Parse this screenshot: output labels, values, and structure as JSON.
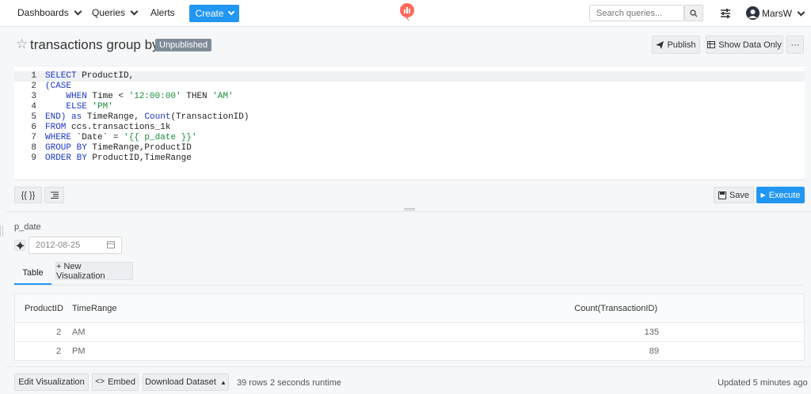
{
  "nav": {
    "dashboards": "Dashboards",
    "queries": "Queries",
    "alerts": "Alerts",
    "create": "Create",
    "search_placeholder": "Search queries...",
    "user": "MarsW"
  },
  "query": {
    "title": "transactions group by",
    "status_badge": "Unpublished",
    "publish": "Publish",
    "show_data_only": "Show Data Only",
    "more": "···"
  },
  "editor": {
    "lines": [
      {
        "n": "1",
        "html": "<span class=\"kw\">SELECT</span> ProductID,"
      },
      {
        "n": "2",
        "html": "<span class=\"kw\">(CASE</span>"
      },
      {
        "n": "3",
        "html": "    <span class=\"kw\">WHEN</span> Time &lt; <span class=\"str\">'12:00:00'</span> THEN <span class=\"str\">'AM'</span>"
      },
      {
        "n": "4",
        "html": "    <span class=\"kw\">ELSE</span> <span class=\"str\">'PM'</span>"
      },
      {
        "n": "5",
        "html": "<span class=\"kw\">END)</span> <span class=\"kw\">as</span> TimeRange, <span class=\"kw\">Count</span>(TransactionID)"
      },
      {
        "n": "6",
        "html": "<span class=\"kw\">FROM</span> ccs.transactions_1k"
      },
      {
        "n": "7",
        "html": "<span class=\"kw\">WHERE</span> `Date` = <span class=\"str\">'{{ p_date }}'</span>"
      },
      {
        "n": "8",
        "html": "<span class=\"kw\">GROUP BY</span> TimeRange,ProductID"
      },
      {
        "n": "9",
        "html": "<span class=\"kw\">ORDER BY</span> ProductID,TimeRange"
      }
    ],
    "param_button": "{{ }}",
    "save": "Save",
    "execute": "Execute"
  },
  "parameter": {
    "name": "p_date",
    "value": "2012-08-25"
  },
  "tabs": {
    "table": "Table",
    "new_visualization": "+ New Visualization"
  },
  "table": {
    "columns": [
      "ProductID",
      "TimeRange",
      "Count(TransactionID)"
    ],
    "rows": [
      [
        "2",
        "AM",
        "135"
      ],
      [
        "2",
        "PM",
        "89"
      ]
    ]
  },
  "footer": {
    "edit_visualization": "Edit Visualization",
    "embed": "Embed",
    "download_dataset": "Download Dataset",
    "rows": "39 rows",
    "runtime": "2 seconds runtime",
    "updated": "Updated 5 minutes ago"
  },
  "colors": {
    "primary": "#2196f3",
    "badge": "#7e8c99",
    "keyword": "#1a37c9",
    "string": "#1a8c3a"
  }
}
